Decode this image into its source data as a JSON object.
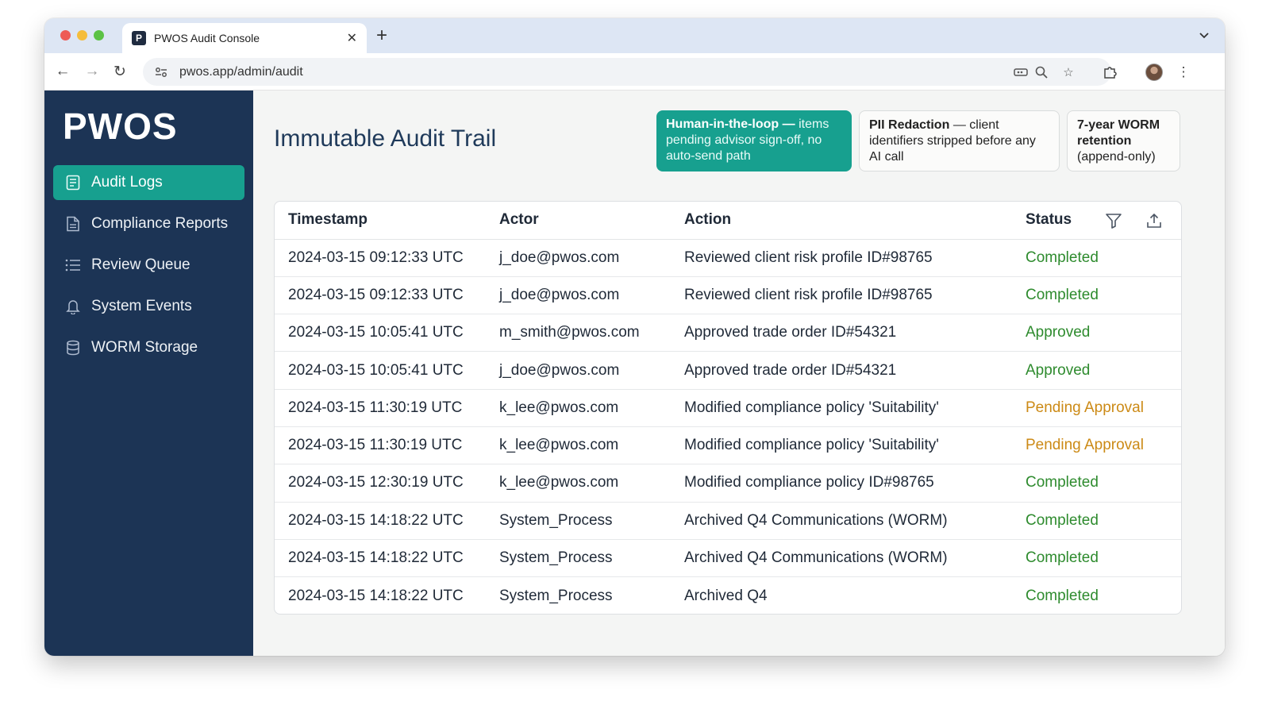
{
  "browser": {
    "tab_title": "PWOS Audit Console",
    "tab_favicon_letter": "P",
    "url": "pwos.app/admin/audit"
  },
  "sidebar": {
    "logo": "PWOS",
    "items": [
      {
        "label": "Audit Logs",
        "icon": "audit-log-icon",
        "active": true
      },
      {
        "label": "Compliance Reports",
        "icon": "document-icon",
        "active": false
      },
      {
        "label": "Review Queue",
        "icon": "list-icon",
        "active": false
      },
      {
        "label": "System Events",
        "icon": "bell-icon",
        "active": false
      },
      {
        "label": "WORM Storage",
        "icon": "database-icon",
        "active": false
      }
    ]
  },
  "main": {
    "title": "Immutable Audit Trail",
    "badges": {
      "hitl": {
        "bold": "Human-in-the-loop —",
        "text": "items pending advisor sign-off, no auto-send path"
      },
      "pii": {
        "bold": "PII Redaction",
        "text": "— client identifiers stripped before any AI call"
      },
      "worm": {
        "bold": "7-year WORM retention",
        "text": "(append-only)"
      }
    },
    "table": {
      "columns": [
        "Timestamp",
        "Actor",
        "Action",
        "Status"
      ],
      "rows": [
        {
          "timestamp": "2024-03-15 09:12:33 UTC",
          "actor": "j_doe@pwos.com",
          "action": "Reviewed client risk profile ID#98765",
          "status": "Completed"
        },
        {
          "timestamp": "2024-03-15 09:12:33 UTC",
          "actor": "j_doe@pwos.com",
          "action": "Reviewed client risk profile ID#98765",
          "status": "Completed"
        },
        {
          "timestamp": "2024-03-15 10:05:41 UTC",
          "actor": "m_smith@pwos.com",
          "action": "Approved trade order ID#54321",
          "status": "Approved"
        },
        {
          "timestamp": "2024-03-15 10:05:41 UTC",
          "actor": "j_doe@pwos.com",
          "action": "Approved trade order ID#54321",
          "status": "Approved"
        },
        {
          "timestamp": "2024-03-15 11:30:19 UTC",
          "actor": "k_lee@pwos.com",
          "action": "Modified compliance policy 'Suitability'",
          "status": "Pending Approval"
        },
        {
          "timestamp": "2024-03-15 11:30:19 UTC",
          "actor": "k_lee@pwos.com",
          "action": "Modified compliance policy 'Suitability'",
          "status": "Pending Approval"
        },
        {
          "timestamp": "2024-03-15 12:30:19 UTC",
          "actor": "k_lee@pwos.com",
          "action": "Modified compliance policy ID#98765",
          "status": "Completed"
        },
        {
          "timestamp": "2024-03-15 14:18:22 UTC",
          "actor": "System_Process",
          "action": "Archived Q4 Communications (WORM)",
          "status": "Completed"
        },
        {
          "timestamp": "2024-03-15 14:18:22 UTC",
          "actor": "System_Process",
          "action": "Archived Q4 Communications (WORM)",
          "status": "Completed"
        },
        {
          "timestamp": "2024-03-15 14:18:22 UTC",
          "actor": "System_Process",
          "action": "Archived Q4",
          "status": "Completed"
        }
      ]
    }
  },
  "colors": {
    "sidebar_bg": "#1c3455",
    "accent_teal": "#17a08f",
    "status_green": "#2e8b2e",
    "status_pending": "#cc8a16",
    "title_navy": "#1f3a5a"
  }
}
